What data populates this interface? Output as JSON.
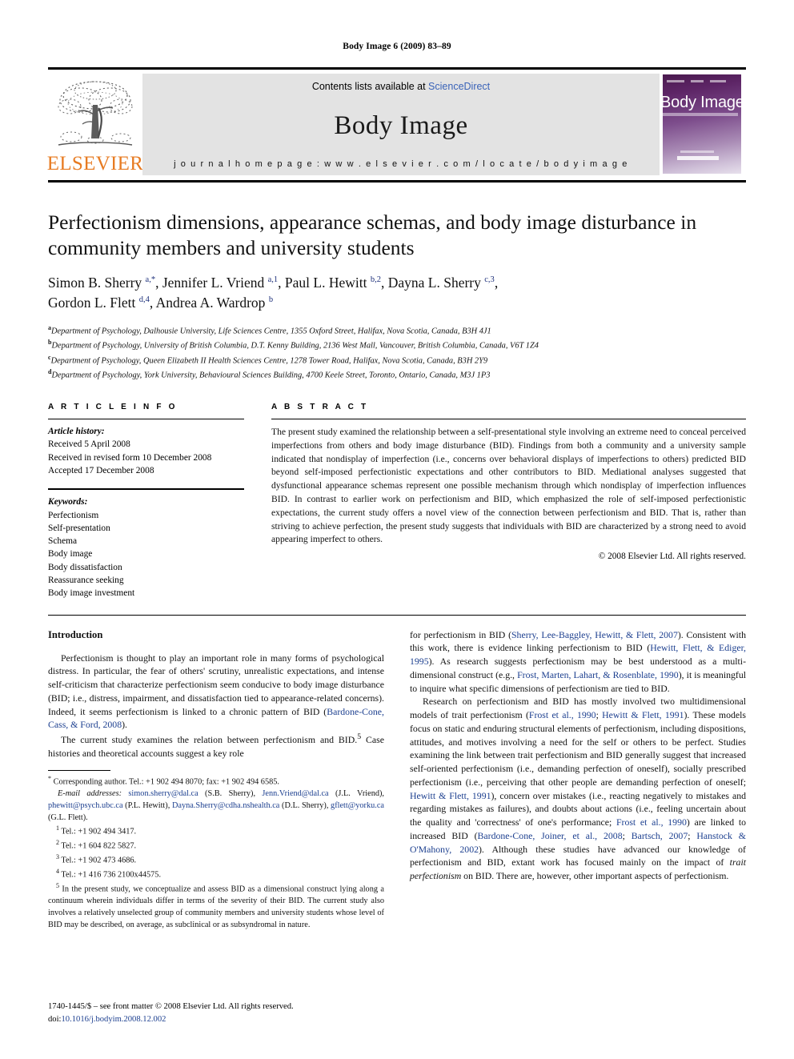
{
  "running_head": "Body Image 6 (2009) 83–89",
  "masthead": {
    "publisher_name": "ELSEVIER",
    "contents_prefix": "Contents lists available at ",
    "sciencedirect": "ScienceDirect",
    "journal_name": "Body Image",
    "homepage": "j o u r n a l   h o m e p a g e :   w w w . e l s e v i e r . c o m / l o c a t e / b o d y i m a g e",
    "cover_title": "Body Image"
  },
  "article": {
    "title": "Perfectionism dimensions, appearance schemas, and body image disturbance in community members and university students",
    "authors_line1_a": "Simon B. Sherry ",
    "authors_line1_a_sup": "a,*",
    "authors_line1_b": ", Jennifer L. Vriend ",
    "authors_line1_b_sup": "a,1",
    "authors_line1_c": ", Paul L. Hewitt ",
    "authors_line1_c_sup": "b,2",
    "authors_line1_d": ", Dayna L. Sherry ",
    "authors_line1_d_sup": "c,3",
    "authors_line1_end": ",",
    "authors_line2_a": "Gordon L. Flett ",
    "authors_line2_a_sup": "d,4",
    "authors_line2_b": ", Andrea A. Wardrop ",
    "authors_line2_b_sup": "b",
    "affiliations": [
      {
        "marker": "a",
        "text": "Department of Psychology, Dalhousie University, Life Sciences Centre, 1355 Oxford Street, Halifax, Nova Scotia, Canada, B3H 4J1"
      },
      {
        "marker": "b",
        "text": "Department of Psychology, University of British Columbia, D.T. Kenny Building, 2136 West Mall, Vancouver, British Columbia, Canada, V6T 1Z4"
      },
      {
        "marker": "c",
        "text": "Department of Psychology, Queen Elizabeth II Health Sciences Centre, 1278 Tower Road, Halifax, Nova Scotia, Canada, B3H 2Y9"
      },
      {
        "marker": "d",
        "text": "Department of Psychology, York University, Behavioural Sciences Building, 4700 Keele Street, Toronto, Ontario, Canada, M3J 1P3"
      }
    ]
  },
  "article_info": {
    "heading": "A R T I C L E  I N F O",
    "history_label": "Article history:",
    "history": [
      "Received 5 April 2008",
      "Received in revised form 10 December 2008",
      "Accepted 17 December 2008"
    ],
    "keywords_label": "Keywords:",
    "keywords": [
      "Perfectionism",
      "Self-presentation",
      "Schema",
      "Body image",
      "Body dissatisfaction",
      "Reassurance seeking",
      "Body image investment"
    ]
  },
  "abstract": {
    "heading": "A B S T R A C T",
    "text": "The present study examined the relationship between a self-presentational style involving an extreme need to conceal perceived imperfections from others and body image disturbance (BID). Findings from both a community and a university sample indicated that nondisplay of imperfection (i.e., concerns over behavioral displays of imperfections to others) predicted BID beyond self-imposed perfectionistic expectations and other contributors to BID. Mediational analyses suggested that dysfunctional appearance schemas represent one possible mechanism through which nondisplay of imperfection influences BID. In contrast to earlier work on perfectionism and BID, which emphasized the role of self-imposed perfectionistic expectations, the current study offers a novel view of the connection between perfectionism and BID. That is, rather than striving to achieve perfection, the present study suggests that individuals with BID are characterized by a strong need to avoid appearing imperfect to others.",
    "copyright": "© 2008 Elsevier Ltd. All rights reserved."
  },
  "body": {
    "intro_heading": "Introduction",
    "left_p1_a": "Perfectionism is thought to play an important role in many forms of psychological distress. In particular, the fear of others' scrutiny, unrealistic expectations, and intense self-criticism that characterize perfectionism seem conducive to body image disturbance (BID; i.e., distress, impairment, and dissatisfaction tied to appearance-related concerns). Indeed, it seems perfectionism is linked to a chronic pattern of BID (",
    "left_p1_cite": "Bardone-Cone, Cass, & Ford, 2008",
    "left_p1_b": ").",
    "left_p2_a": "The current study examines the relation between perfectionism and BID.",
    "left_p2_sup": "5",
    "left_p2_b": " Case histories and theoretical accounts suggest a key role",
    "right_p1_a": "for perfectionism in BID (",
    "right_p1_cite1": "Sherry, Lee-Baggley, Hewitt, & Flett, 2007",
    "right_p1_b": "). Consistent with this work, there is evidence linking perfectionism to BID (",
    "right_p1_cite2": "Hewitt, Flett, & Ediger, 1995",
    "right_p1_c": "). As research suggests perfectionism may be best understood as a multi-dimensional construct (e.g., ",
    "right_p1_cite3": "Frost, Marten, Lahart, & Rosenblate, 1990",
    "right_p1_d": "), it is meaningful to inquire what specific dimensions of perfectionism are tied to BID.",
    "right_p2_a": "Research on perfectionism and BID has mostly involved two multidimensional models of trait perfectionism (",
    "right_p2_cite1": "Frost et al., 1990",
    "right_p2_semi": "; ",
    "right_p2_cite2": "Hewitt & Flett, 1991",
    "right_p2_b": "). These models focus on static and enduring structural elements of perfectionism, including dispositions, attitudes, and motives involving a need for the self or others to be perfect. Studies examining the link between trait perfectionism and BID generally suggest that increased self-oriented perfectionism (i.e., demanding perfection of oneself), socially prescribed perfectionism (i.e., perceiving that other people are demanding perfection of oneself; ",
    "right_p2_cite3": "Hewitt & Flett, 1991",
    "right_p2_c": "), concern over mistakes (i.e., reacting negatively to mistakes and regarding mistakes as failures), and doubts about actions (i.e., feeling uncertain about the quality and 'correctness' of one's performance; ",
    "right_p2_cite4": "Frost et al., 1990",
    "right_p2_d": ") are linked to increased BID (",
    "right_p2_cite5": "Bardone-Cone, Joiner, et al., 2008",
    "right_p2_e": "; ",
    "right_p2_cite6": "Bartsch, 2007",
    "right_p2_f": "; ",
    "right_p2_cite7": "Hanstock & O'Mahony, 2002",
    "right_p2_g": "). Although these studies have advanced our knowledge of perfectionism and BID, extant work has focused mainly on the impact of ",
    "right_p2_italic": "trait perfectionism",
    "right_p2_h": " on BID. There are, however, other important aspects of perfectionism."
  },
  "footnotes": {
    "corresponding_marker": "*",
    "corresponding": " Corresponding author. Tel.: +1 902 494 8070; fax: +1 902 494 6585.",
    "email_label": "E-mail addresses:",
    "email_1": "simon.sherry@dal.ca",
    "email_1_owner": " (S.B. Sherry), ",
    "email_2": "Jenn.Vriend@dal.ca",
    "email_2_owner": " (J.L. Vriend), ",
    "email_3": "phewitt@psych.ubc.ca",
    "email_3_owner": " (P.L. Hewitt), ",
    "email_4": "Dayna.Sherry@cdha.nshealth.ca",
    "email_4_owner": " (D.L. Sherry), ",
    "email_5": "gflett@yorku.ca",
    "email_5_owner": " (G.L. Flett).",
    "notes": [
      {
        "marker": "1",
        "text": " Tel.: +1 902 494 3417."
      },
      {
        "marker": "2",
        "text": " Tel.: +1 604 822 5827."
      },
      {
        "marker": "3",
        "text": " Tel.: +1 902 473 4686."
      },
      {
        "marker": "4",
        "text": " Tel.: +1 416 736 2100x44575."
      }
    ],
    "note5_marker": "5",
    "note5": " In the present study, we conceptualize and assess BID as a dimensional construct lying along a continuum wherein individuals differ in terms of the severity of their BID. The current study also involves a relatively unselected group of community members and university students whose level of BID may be described, on average, as subclinical or as subsyndromal in nature."
  },
  "page_footer": {
    "issn_line": "1740-1445/$ – see front matter © 2008 Elsevier Ltd. All rights reserved.",
    "doi_prefix": "doi:",
    "doi": "10.1016/j.bodyim.2008.12.002"
  },
  "colors": {
    "elsevier_orange": "#E77B22",
    "link_blue": "#1c3f8f",
    "sciencedirect_blue": "#3a63b8",
    "masthead_grey": "#e3e3e3",
    "cover_purple": "#4a1a4f"
  }
}
